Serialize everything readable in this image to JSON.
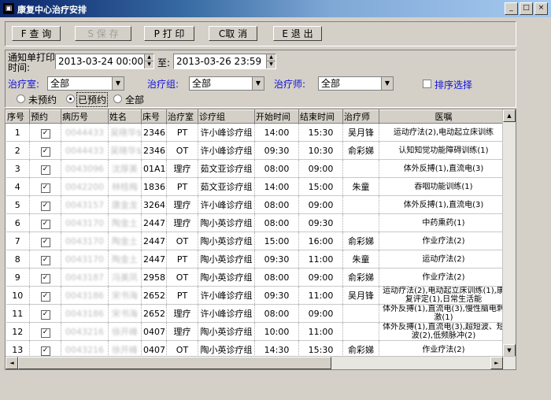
{
  "window": {
    "title": "康复中心治疗安排",
    "icon": "app-icon",
    "min": "_",
    "max": "□",
    "close": "×"
  },
  "toolbar": {
    "query": "F 查 询",
    "save": "S 保 存",
    "print": "P 打 印",
    "cancel": "C取 消",
    "exit": "E 退 出"
  },
  "filter": {
    "notify_label": "通知单打印时间:",
    "from": "2013-03-24 00:00",
    "to_label": "至:",
    "to": "2013-03-26 23:59",
    "room_label": "治疗室:",
    "room_value": "全部",
    "group_label": "治疗组:",
    "group_value": "全部",
    "therapist_label": "治疗师:",
    "therapist_value": "全部",
    "sort_label": "排序选择",
    "radio_unbooked": "未预约",
    "radio_booked": "已预约",
    "radio_all": "全部"
  },
  "grid": {
    "columns": [
      "序号",
      "预约",
      "病历号",
      "姓名",
      "床号",
      "治疗室",
      "诊疗组",
      "开始时间",
      "结束时间",
      "治疗师",
      "医嘱"
    ],
    "rows": [
      {
        "no": "1",
        "booked": "✓",
        "record": "0044433",
        "name": "吴晓华$",
        "bed": "2346",
        "room": "PT",
        "group": "许小峰诊疗组",
        "start": "14:00",
        "end": "15:30",
        "therapist": "吴月锋",
        "order": "运动疗法(2),电动起立床训练"
      },
      {
        "no": "2",
        "booked": "✓",
        "record": "0044433",
        "name": "吴晓华$",
        "bed": "2346",
        "room": "OT",
        "group": "许小峰诊疗组",
        "start": "09:30",
        "end": "10:30",
        "therapist": "俞彩娣",
        "order": "认知知觉功能障碍训练(1)"
      },
      {
        "no": "3",
        "booked": "✓",
        "record": "0043096",
        "name": "沈厚美",
        "bed": "01A1",
        "room": "理疗",
        "group": "茹文亚诊疗组",
        "start": "08:00",
        "end": "09:00",
        "therapist": "",
        "order": "体外反搏(1),直流电(3)"
      },
      {
        "no": "4",
        "booked": "✓",
        "record": "0042200",
        "name": "林桂梅",
        "bed": "1836",
        "room": "PT",
        "group": "茹文亚诊疗组",
        "start": "14:00",
        "end": "15:00",
        "therapist": "朱童",
        "order": "吞咽功能训练(1)"
      },
      {
        "no": "5",
        "booked": "✓",
        "record": "0043157",
        "name": "唐金龙",
        "bed": "3264",
        "room": "理疗",
        "group": "许小峰诊疗组",
        "start": "08:00",
        "end": "09:00",
        "therapist": "",
        "order": "体外反搏(1),直流电(3)"
      },
      {
        "no": "6",
        "booked": "✓",
        "record": "0043170",
        "name": "陶金土",
        "bed": "2447",
        "room": "理疗",
        "group": "陶小英诊疗组",
        "start": "08:00",
        "end": "09:30",
        "therapist": "",
        "order": "中药熏药(1)"
      },
      {
        "no": "7",
        "booked": "✓",
        "record": "0043170",
        "name": "陶金土",
        "bed": "2447",
        "room": "OT",
        "group": "陶小英诊疗组",
        "start": "15:00",
        "end": "16:00",
        "therapist": "俞彩娣",
        "order": "作业疗法(2)"
      },
      {
        "no": "8",
        "booked": "✓",
        "record": "0043170",
        "name": "陶金土",
        "bed": "2447",
        "room": "PT",
        "group": "陶小英诊疗组",
        "start": "09:30",
        "end": "11:00",
        "therapist": "朱童",
        "order": "运动疗法(2)"
      },
      {
        "no": "9",
        "booked": "✓",
        "record": "0043187",
        "name": "冯美凤",
        "bed": "2958",
        "room": "OT",
        "group": "陶小英诊疗组",
        "start": "08:00",
        "end": "09:00",
        "therapist": "俞彩娣",
        "order": "作业疗法(2)"
      },
      {
        "no": "10",
        "booked": "✓",
        "record": "0043186",
        "name": "宋书海",
        "bed": "2652",
        "room": "PT",
        "group": "许小峰诊疗组",
        "start": "09:30",
        "end": "11:00",
        "therapist": "吴月锋",
        "order": "运动疗法(2),电动起立床训练(1),康复评定(1),日常生活能"
      },
      {
        "no": "11",
        "booked": "✓",
        "record": "0043186",
        "name": "宋书海",
        "bed": "2652",
        "room": "理疗",
        "group": "许小峰诊疗组",
        "start": "08:00",
        "end": "09:00",
        "therapist": "",
        "order": "体外反搏(1),直流电(3),慢性脑电刺激(1)"
      },
      {
        "no": "12",
        "booked": "✓",
        "record": "0043216",
        "name": "徐开峰",
        "bed": "0407",
        "room": "理疗",
        "group": "陶小英诊疗组",
        "start": "10:00",
        "end": "11:00",
        "therapist": "",
        "order": "体外反搏(1),直流电(3),超短波、短波(2),低频脉冲(2)"
      },
      {
        "no": "13",
        "booked": "✓",
        "record": "0043216",
        "name": "徐开峰",
        "bed": "0407",
        "room": "OT",
        "group": "陶小英诊疗组",
        "start": "14:30",
        "end": "15:30",
        "therapist": "俞彩娣",
        "order": "作业疗法(2)"
      }
    ]
  },
  "scroll": {
    "up": "▲",
    "down": "▼",
    "left": "◄",
    "right": "►"
  }
}
